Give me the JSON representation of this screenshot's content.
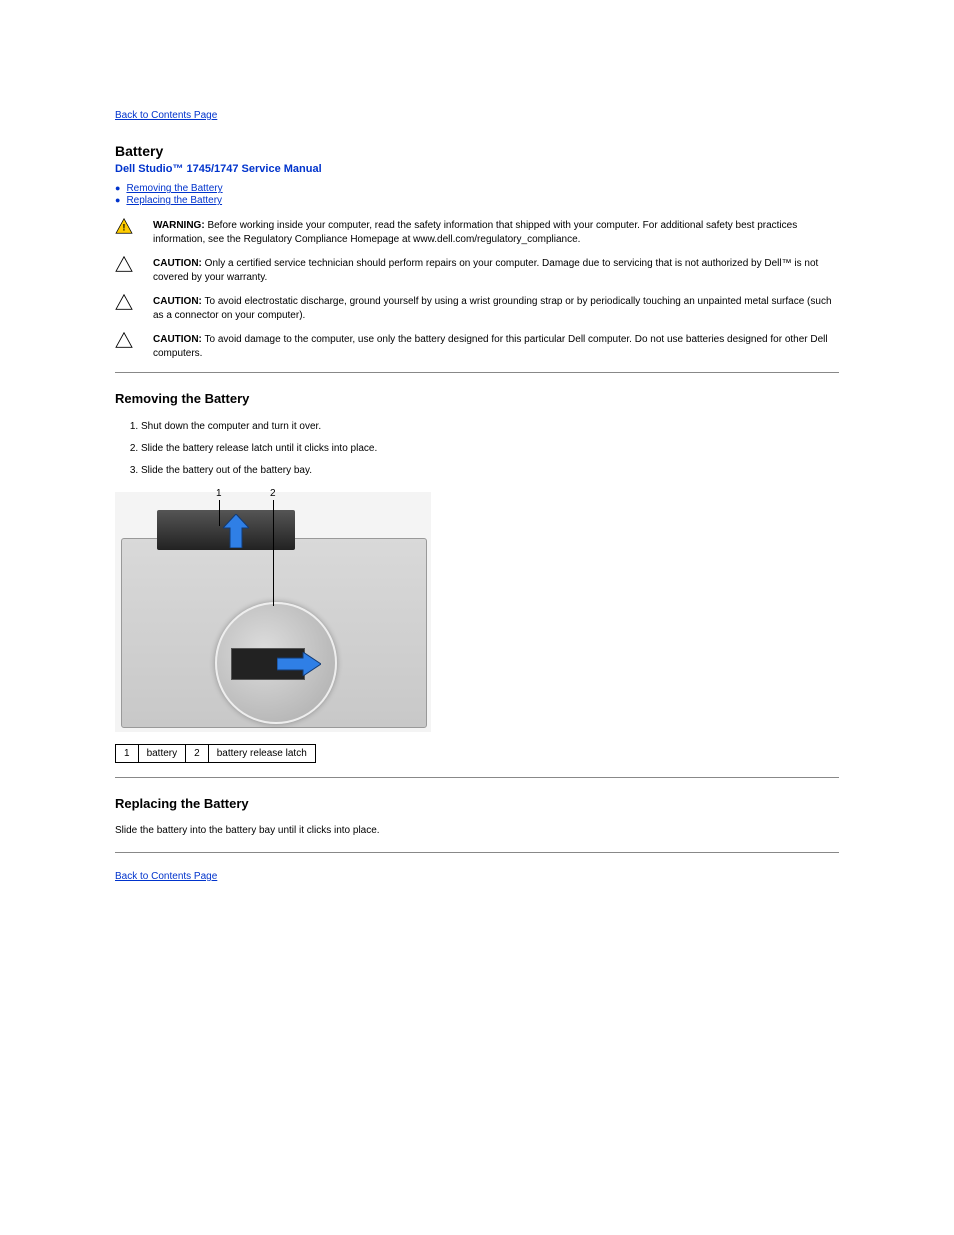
{
  "nav": {
    "back": "Back to Contents Page",
    "back2": "Back to Contents Page"
  },
  "header": {
    "section_title": "Battery",
    "manual_title": "Dell Studio™ 1745/1747 Service Manual"
  },
  "toc": {
    "remove": "Removing the Battery",
    "replace": "Replacing the Battery"
  },
  "alerts": {
    "warn_label": "WARNING:",
    "warn_text": "Before working inside your computer, read the safety information that shipped with your computer. For additional safety best practices information, see the Regulatory Compliance Homepage at www.dell.com/regulatory_compliance.",
    "c1_label": "CAUTION:",
    "c1_text": "Only a certified service technician should perform repairs on your computer. Damage due to servicing that is not authorized by Dell™ is not covered by your warranty.",
    "c2_label": "CAUTION:",
    "c2_text": "To avoid electrostatic discharge, ground yourself by using a wrist grounding strap or by periodically touching an unpainted metal surface (such as a connector on your computer).",
    "c3_label": "CAUTION:",
    "c3_text": "To avoid damage to the computer, use only the battery designed for this particular Dell computer. Do not use batteries designed for other Dell computers."
  },
  "remove": {
    "heading": "Removing the Battery",
    "steps": [
      "Shut down the computer and turn it over.",
      "Slide the battery release latch until it clicks into place.",
      "Slide the battery out of the battery bay."
    ]
  },
  "legend": {
    "c1n": "1",
    "c1t": "battery",
    "c2n": "2",
    "c2t": "battery release latch"
  },
  "replace": {
    "heading": "Replacing the Battery",
    "step": "Slide the battery into the battery bay until it clicks into place."
  },
  "callouts": {
    "one": "1",
    "two": "2"
  }
}
